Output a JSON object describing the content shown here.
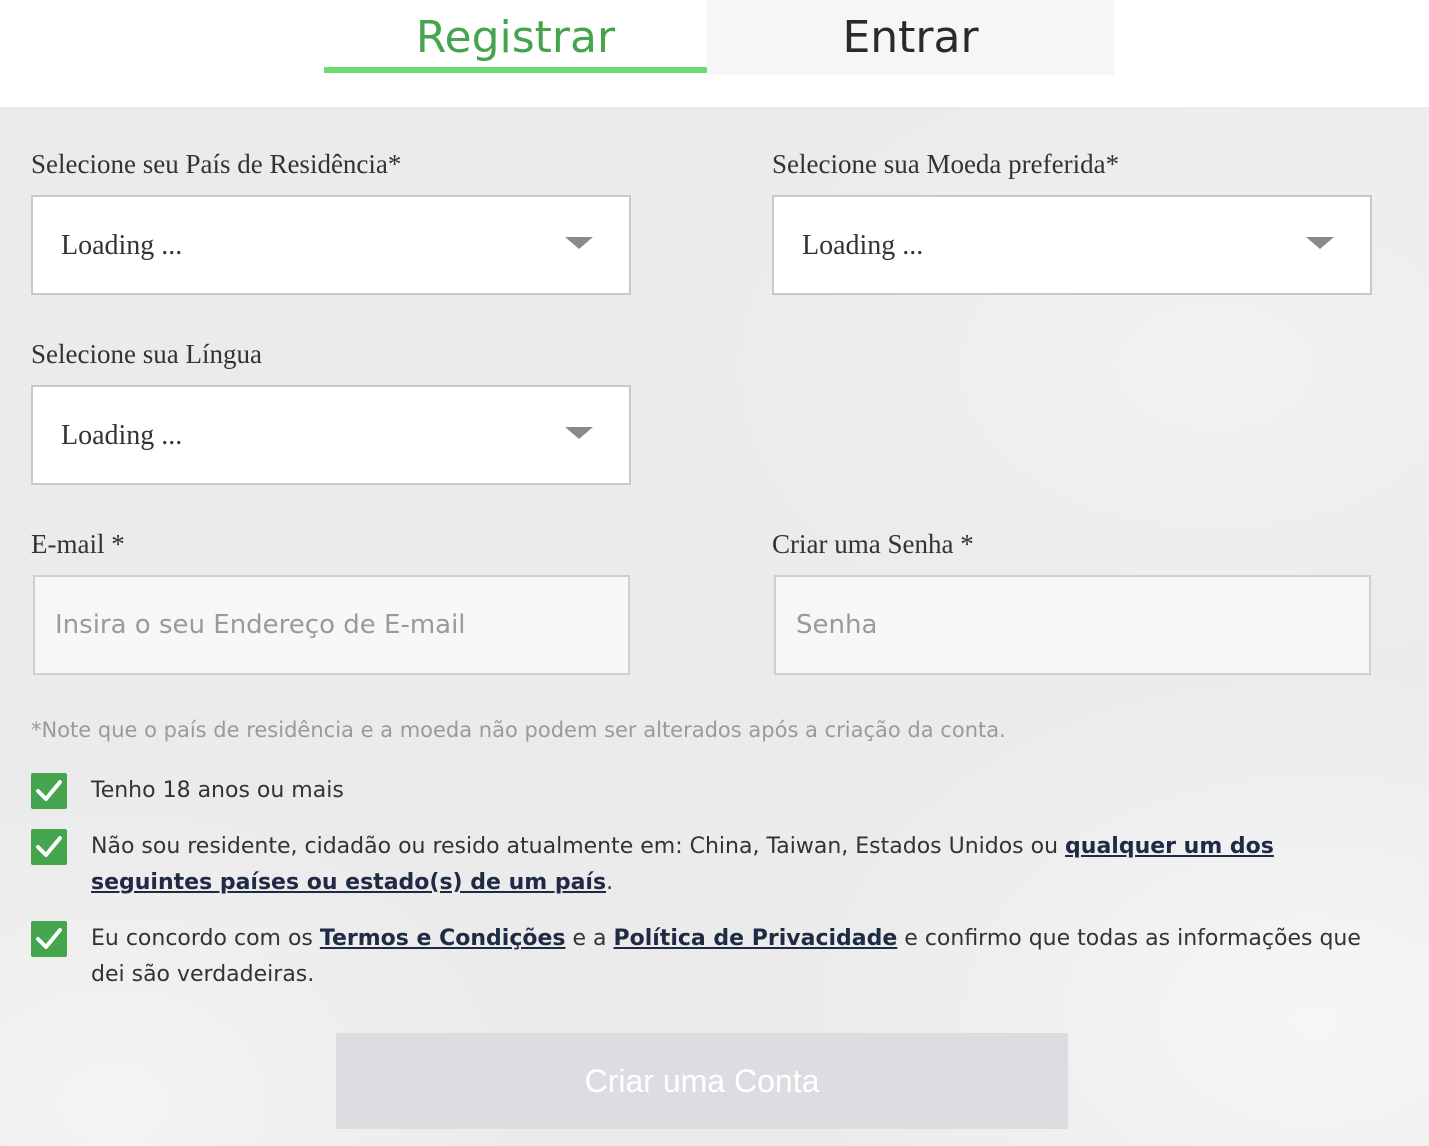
{
  "tabs": {
    "register": "Registrar",
    "login": "Entrar"
  },
  "form": {
    "country": {
      "label": "Selecione seu País de Residência*",
      "value": "Loading ..."
    },
    "currency": {
      "label": "Selecione sua Moeda preferida*",
      "value": "Loading ..."
    },
    "language": {
      "label": "Selecione sua Língua",
      "value": "Loading ..."
    },
    "email": {
      "label": "E-mail *",
      "placeholder": "Insira o seu Endereço de E-mail"
    },
    "password": {
      "label": "Criar uma Senha *",
      "placeholder": "Senha"
    },
    "note": "*Note que o país de residência e a moeda não podem ser alterados após a criação da conta.",
    "checks": {
      "age": "Tenho 18 anos ou mais",
      "residence_pre": "Não sou residente, cidadão ou resido atualmente em: China, Taiwan, Estados Unidos ou ",
      "residence_link": "qualquer um dos seguintes países ou estado(s) de um país",
      "residence_post": ".",
      "terms_pre": "Eu concordo com os ",
      "terms_link": "Termos e Condições",
      "terms_mid": " e a ",
      "privacy_link": "Política de Privacidade",
      "terms_post": " e confirmo que todas as informações que dei são verdadeiras."
    },
    "submit": "Criar uma Conta"
  },
  "colors": {
    "accent_green": "#45a44e",
    "tab_underline": "#6ddb73",
    "button_disabled": "#dcdde0"
  }
}
